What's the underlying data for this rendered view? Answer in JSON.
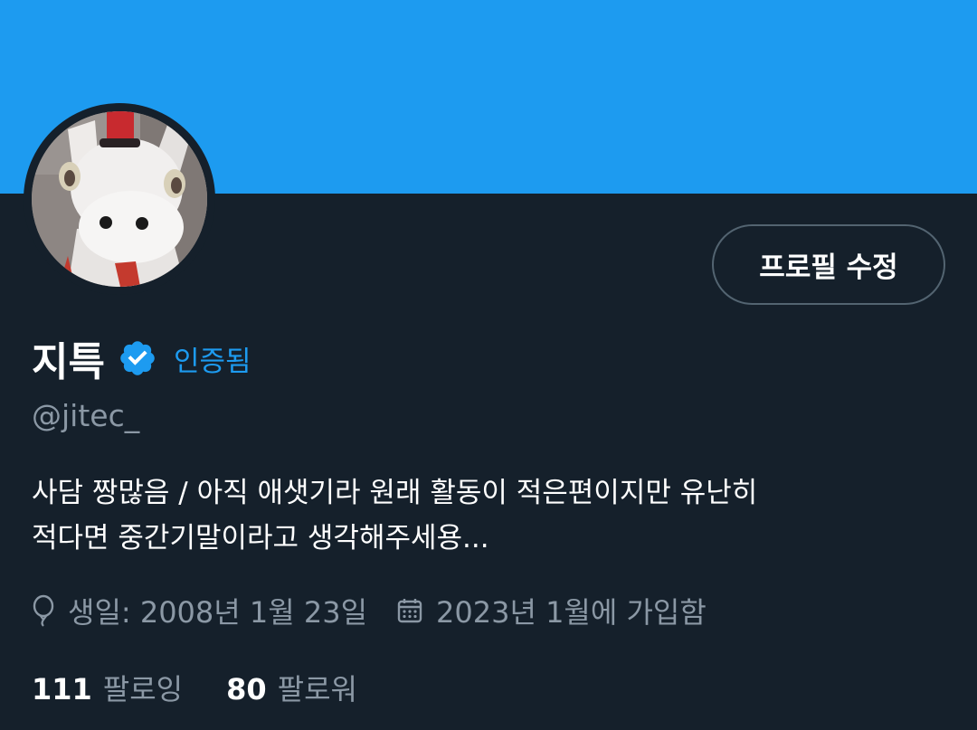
{
  "profile": {
    "display_name": "지특",
    "verified_label": "인증됨",
    "handle": "@jitec_",
    "edit_button_label": "프로필 수정",
    "bio_line_1": "사담 짱많음 / 아직 애샛기라 원래 활동이 적은편이지만 유난히",
    "bio_line_2": "적다면 중간기말이라고 생각해주세용...",
    "birthday": "생일: 2008년 1월 23일",
    "joined": "2023년 1월에 가입함",
    "following_count": "111",
    "following_label": "팔로잉",
    "followers_count": "80",
    "followers_label": "팔로워"
  },
  "icons": {
    "verified": "verified-badge-icon",
    "birthday": "balloon-icon",
    "joined": "calendar-icon"
  },
  "colors": {
    "banner": "#1d9bf0",
    "background": "#15202b",
    "accent": "#1d9bf0",
    "secondary_text": "#8b98a5",
    "button_border": "#536471"
  }
}
